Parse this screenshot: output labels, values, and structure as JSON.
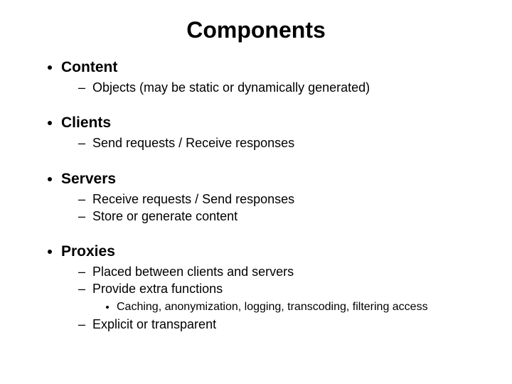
{
  "title": "Components",
  "items": [
    {
      "label": "Content",
      "sub": [
        {
          "label": "Objects (may be static or dynamically generated)"
        }
      ]
    },
    {
      "label": "Clients",
      "sub": [
        {
          "label": "Send requests / Receive responses"
        }
      ]
    },
    {
      "label": "Servers",
      "sub": [
        {
          "label": "Receive requests / Send responses"
        },
        {
          "label": "Store or generate content"
        }
      ]
    },
    {
      "label": "Proxies",
      "sub": [
        {
          "label": "Placed between clients and servers"
        },
        {
          "label": "Provide extra functions",
          "sub": [
            {
              "label": "Caching, anonymization, logging, transcoding, filtering access"
            }
          ]
        },
        {
          "label": "Explicit or transparent"
        }
      ]
    }
  ]
}
